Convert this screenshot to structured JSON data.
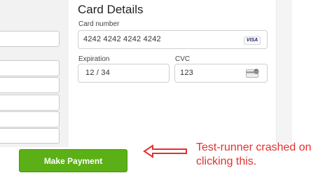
{
  "card": {
    "title": "Card Details",
    "number_label": "Card number",
    "number_value": "4242 4242 4242 4242",
    "brand_badge": "VISA",
    "expiration_label": "Expiration",
    "expiration_value": "12 / 34",
    "cvc_label": "CVC",
    "cvc_value": "123"
  },
  "actions": {
    "pay_label": "Make Payment"
  },
  "annotation": {
    "text": "Test-runner crashed on clicking this.",
    "color": "#e3302f"
  },
  "icons": {
    "brand": "visa-card-icon",
    "cvc": "cvc-card-icon",
    "arrow": "left-arrow-icon"
  },
  "colors": {
    "button_bg": "#5cb017",
    "annotation": "#e3302f"
  }
}
